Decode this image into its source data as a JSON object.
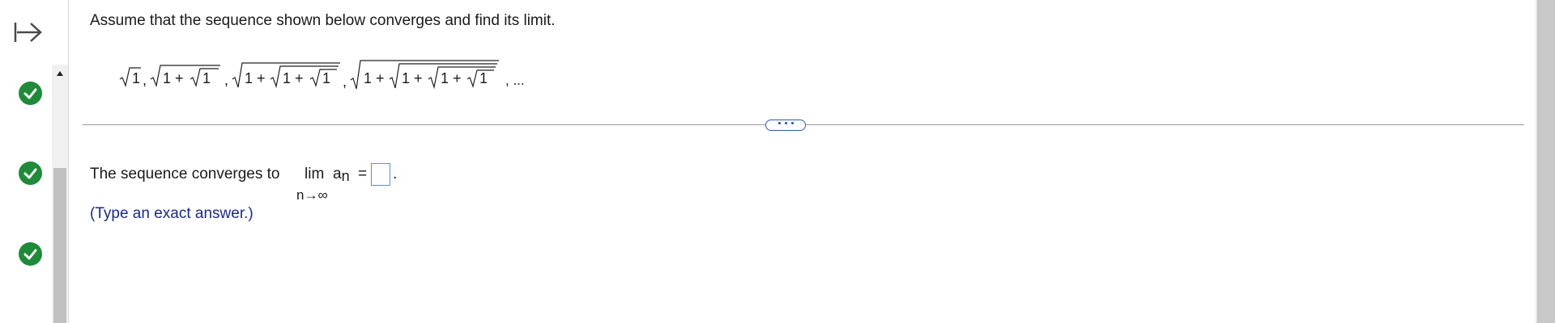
{
  "question": {
    "prompt": "Assume that the sequence shown below converges and find its limit.",
    "sequence_terms": [
      "√1",
      "√(1 + √1)",
      "√(1 + √(1 + √1))",
      "√(1 + √(1 + √(1 + √1)))"
    ],
    "sequence_tail": ", ..."
  },
  "answer": {
    "label": "The sequence converges to",
    "lim_word": "lim",
    "lim_subscript": "n→∞",
    "an_base": "a",
    "an_sub": "n",
    "equals": "=",
    "input_value": "",
    "period": ".",
    "hint": "(Type an exact answer.)"
  },
  "sidebar": {
    "items": [
      {
        "icon": "check-icon",
        "status": "correct"
      },
      {
        "icon": "check-icon",
        "status": "correct"
      },
      {
        "icon": "check-icon",
        "status": "correct"
      }
    ]
  },
  "colors": {
    "check_green": "#1f8a3a",
    "hint_text": "#1b2a80",
    "link_blue": "#2f5ea8",
    "input_border": "#5a8fd6"
  }
}
